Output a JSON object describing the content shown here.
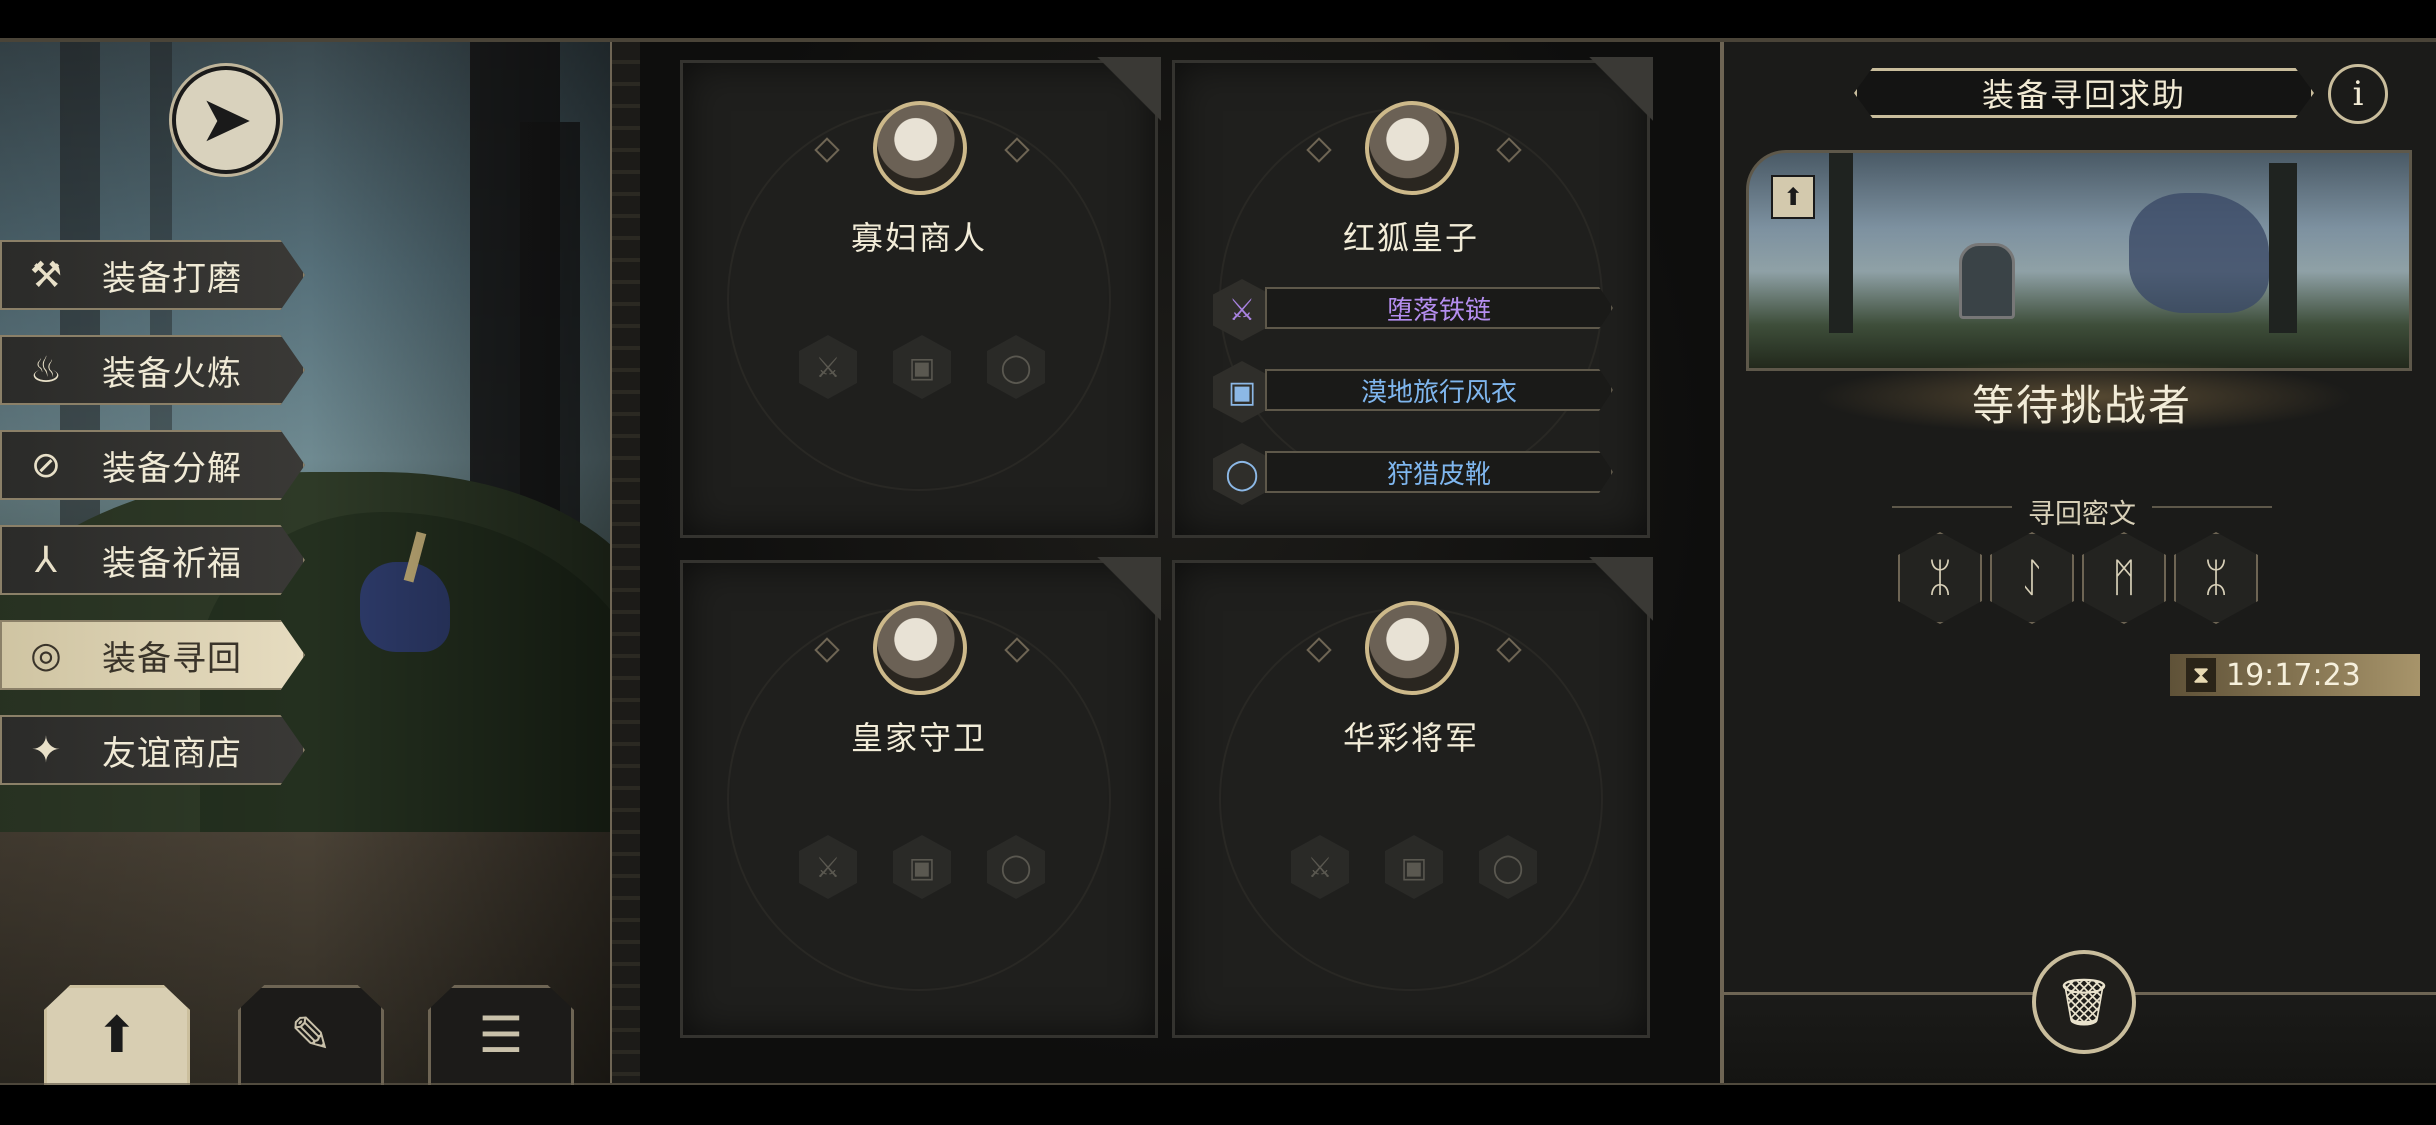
{
  "menu": {
    "items": [
      {
        "label": "装备打磨",
        "icon": "hammer-icon",
        "active": false
      },
      {
        "label": "装备火炼",
        "icon": "flame-icon",
        "active": false
      },
      {
        "label": "装备分解",
        "icon": "decompose-icon",
        "active": false
      },
      {
        "label": "装备祈福",
        "icon": "pray-hands-icon",
        "active": false
      },
      {
        "label": "装备寻回",
        "icon": "target-icon",
        "active": true
      },
      {
        "label": "友谊商店",
        "icon": "fox-icon",
        "active": false
      }
    ]
  },
  "tabs": [
    {
      "icon": "upload-icon",
      "active": true
    },
    {
      "icon": "feather-icon",
      "active": false
    },
    {
      "icon": "list-icon",
      "active": false
    }
  ],
  "cards": [
    {
      "name": "寡妇商人",
      "slots": [
        "sword-icon",
        "armor-icon",
        "ring-icon"
      ],
      "equipment": []
    },
    {
      "name": "红狐皇子",
      "slots": [],
      "equipment": [
        {
          "label": "堕落铁链",
          "icon": "sword-icon",
          "color": "#b58ef0"
        },
        {
          "label": "漠地旅行风衣",
          "icon": "armor-icon",
          "color": "#7fb6ee"
        },
        {
          "label": "狩猎皮靴",
          "icon": "ring-icon",
          "color": "#7fb6ee"
        }
      ]
    },
    {
      "name": "皇家守卫",
      "slots": [
        "sword-icon",
        "armor-icon",
        "ring-icon"
      ],
      "equipment": []
    },
    {
      "name": "华彩将军",
      "slots": [
        "sword-icon",
        "armor-icon",
        "ring-icon"
      ],
      "equipment": []
    }
  ],
  "right_panel": {
    "title": "装备寻回求助",
    "info_label": "i",
    "status": "等待挑战者",
    "runes_label": "寻回密文",
    "runes": [
      "ᛯ",
      "ᛇ",
      "ᛗ",
      "ᛯ"
    ],
    "timer": "19:17:23"
  }
}
